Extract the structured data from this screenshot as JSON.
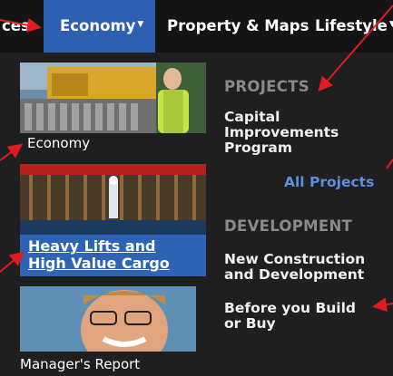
{
  "nav": {
    "items": [
      {
        "label": "ces"
      },
      {
        "label": "Economy",
        "caret": "▼"
      },
      {
        "label": "Property & Maps"
      },
      {
        "label": "Lifestyle",
        "caret": "▼"
      }
    ]
  },
  "cards": [
    {
      "label": "Economy"
    },
    {
      "label_line1": "Heavy Lifts and",
      "label_line2": "High Value Cargo"
    },
    {
      "label": "Manager's Report"
    }
  ],
  "projects": {
    "heading": "PROJECTS",
    "capital_line1": "Capital",
    "capital_line2": "Improvements",
    "capital_line3": "Program",
    "all_projects": "All Projects"
  },
  "development": {
    "heading": "DEVELOPMENT",
    "newcon_line1": "New Construction",
    "newcon_line2": "and Development",
    "before_line1": "Before you Build",
    "before_line2": "or Buy"
  },
  "colors": {
    "nav_bg": "#141414",
    "active_tab": "#2f5fb0",
    "panel_bg": "#1f1f1f",
    "heading": "#8a8a8a",
    "link_blue": "#5b8fe0",
    "annotation_arrow": "#e01b22"
  }
}
